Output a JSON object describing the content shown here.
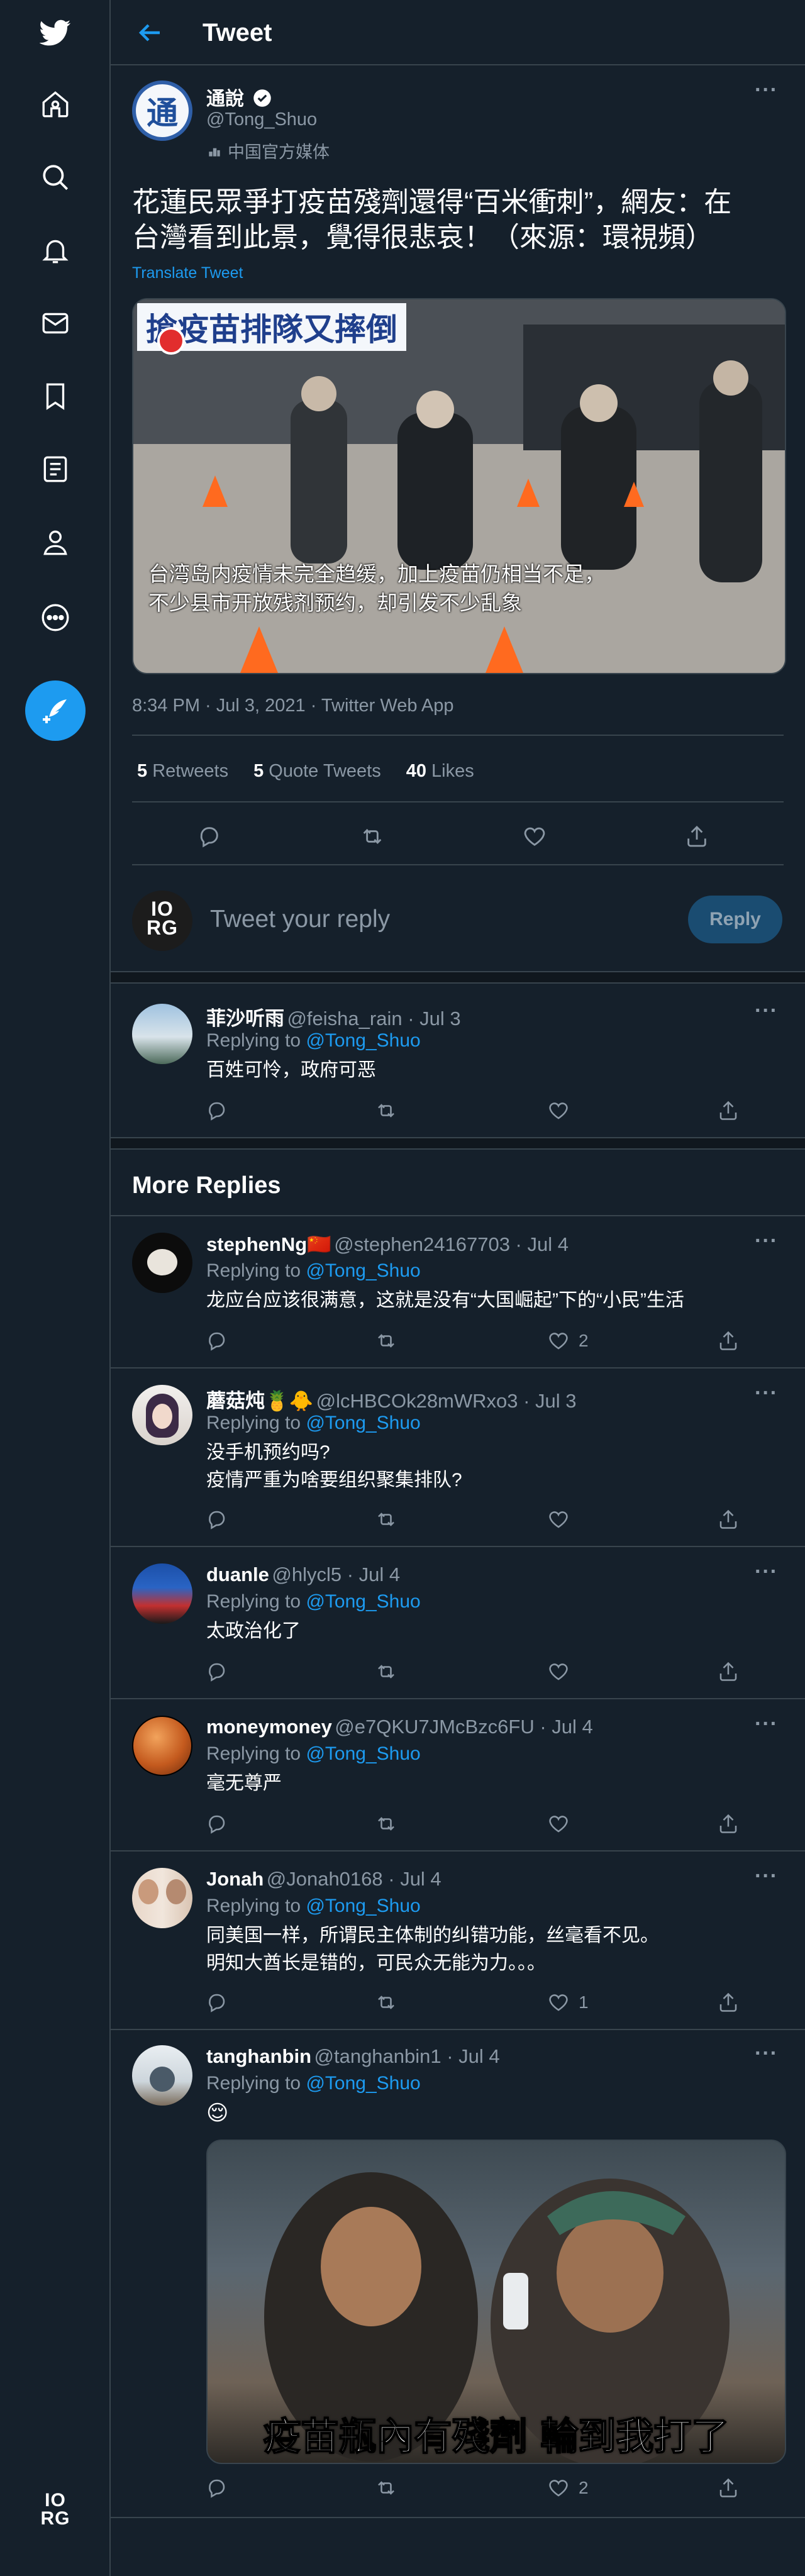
{
  "sidebar": {
    "nav": [
      "twitter-logo-icon",
      "home-icon",
      "search-icon",
      "bell-icon",
      "mail-icon",
      "bookmark-icon",
      "list-icon",
      "profile-icon",
      "more-icon"
    ],
    "compose_icon": "compose-icon",
    "account_logo": [
      "IO",
      "RG"
    ]
  },
  "header": {
    "title": "Tweet"
  },
  "tweet": {
    "author": "通說",
    "handle": "@Tong_Shuo",
    "label": "中国官方媒体",
    "text_line1": "花蓮民眾爭打疫苗殘劑還得“百米衝刺”，網友：在",
    "text_line2": "台灣看到此景，覺得很悲哀！（來源：環視頻）",
    "translate": "Translate Tweet",
    "image_banner": "搶疫苗排隊又摔倒",
    "image_caption_line1": "台湾岛内疫情未完全趋缓，加上疫苗仍相当不足，",
    "image_caption_line2": "不少县市开放残剂预约，却引发不少乱象",
    "meta": "8:34 PM · Jul 3, 2021 · Twitter Web App",
    "stats": {
      "retweets_count": "5",
      "retweets_label": "Retweets",
      "quotes_count": "5",
      "quotes_label": "Quote Tweets",
      "likes_count": "40",
      "likes_label": "Likes"
    }
  },
  "composer": {
    "avatar_text": [
      "IO",
      "RG"
    ],
    "placeholder": "Tweet your reply",
    "button": "Reply"
  },
  "more_replies_title": "More Replies",
  "replying_label": "Replying to",
  "replying_handle": "@Tong_Shuo",
  "replies": [
    {
      "name": "菲沙听雨",
      "handle": "@feisha_rain · Jul 3",
      "lines": [
        "百姓可怜，政府可恶"
      ],
      "likes": ""
    },
    {
      "name": "stephenNg🇨🇳",
      "handle": "@stephen24167703 · Jul 4",
      "lines": [
        "龙应台应该很满意，这就是没有“大国崛起”下的“小民”生活"
      ],
      "likes": "2"
    },
    {
      "name": "蘑菇炖🍍🐥",
      "handle": "@lcHBCOk28mWRxo3 · Jul 3",
      "lines": [
        "没手机预约吗?",
        "疫情严重为啥要组织聚集排队?"
      ],
      "likes": ""
    },
    {
      "name": "duanle",
      "handle": "@hlycl5 · Jul 4",
      "lines": [
        "太政治化了"
      ],
      "likes": ""
    },
    {
      "name": "moneymoney",
      "handle": "@e7QKU7JMcBzc6FU · Jul 4",
      "lines": [
        "毫无尊严"
      ],
      "likes": ""
    },
    {
      "name": "Jonah",
      "handle": "@Jonah0168 · Jul 4",
      "lines": [
        "同美国一样，所谓民主体制的纠错功能，丝毫看不见。",
        "明知大酋长是错的，可民众无能为力。。。"
      ],
      "likes": "1"
    },
    {
      "name": "tanghanbin",
      "handle": "@tanghanbin1 · Jul 4",
      "lines": [
        "😌"
      ],
      "likes": "2",
      "image_caption": "疫苗瓶內有殘劑 輪到我打了"
    }
  ],
  "colors": {
    "background": "#15202b",
    "border": "#38444d",
    "accent": "#1d9bf0",
    "muted": "#8b98a5"
  }
}
